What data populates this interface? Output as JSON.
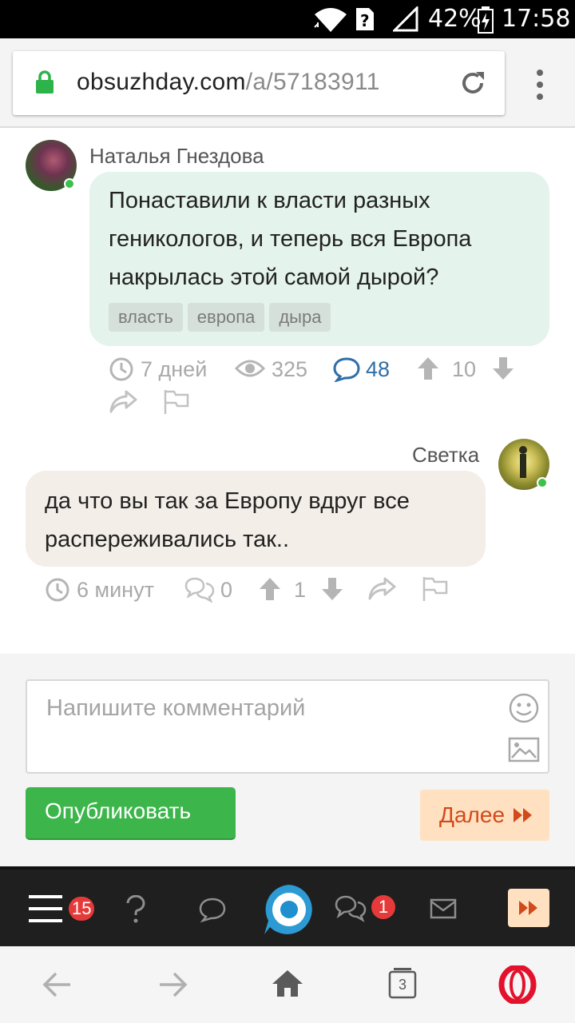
{
  "status_bar": {
    "battery": "42%",
    "time": "17:58"
  },
  "browser": {
    "url_domain": "obsuzhday.com",
    "url_path": "/a/57183911"
  },
  "comments": [
    {
      "author": "Наталья Гнездова",
      "text": "Понаставили к власти разных геникологов, и теперь вся Европа накрылась этой самой дырой?",
      "tags": [
        "власть",
        "европа",
        "дыра"
      ],
      "time": "7 дней",
      "views": "325",
      "replies": "48",
      "upvotes": "10"
    },
    {
      "author": "Светка",
      "text": "да что вы так за Европу вдруг все распереживались так..",
      "time": "6 минут",
      "replies": "0",
      "upvotes": "1"
    }
  ],
  "compose": {
    "placeholder": "Напишите комментарий",
    "publish_label": "Опубликовать",
    "next_label": "Далее"
  },
  "toolbar": {
    "menu_badge": "15",
    "messages_badge": "1"
  },
  "nav": {
    "tabs_count": "3"
  },
  "colors": {
    "accent_green": "#3cb64a",
    "accent_orange": "#d14a1a",
    "bubble_green": "#e4f3ec",
    "bubble_beige": "#f3eee8",
    "link_blue": "#2f6ea8"
  }
}
